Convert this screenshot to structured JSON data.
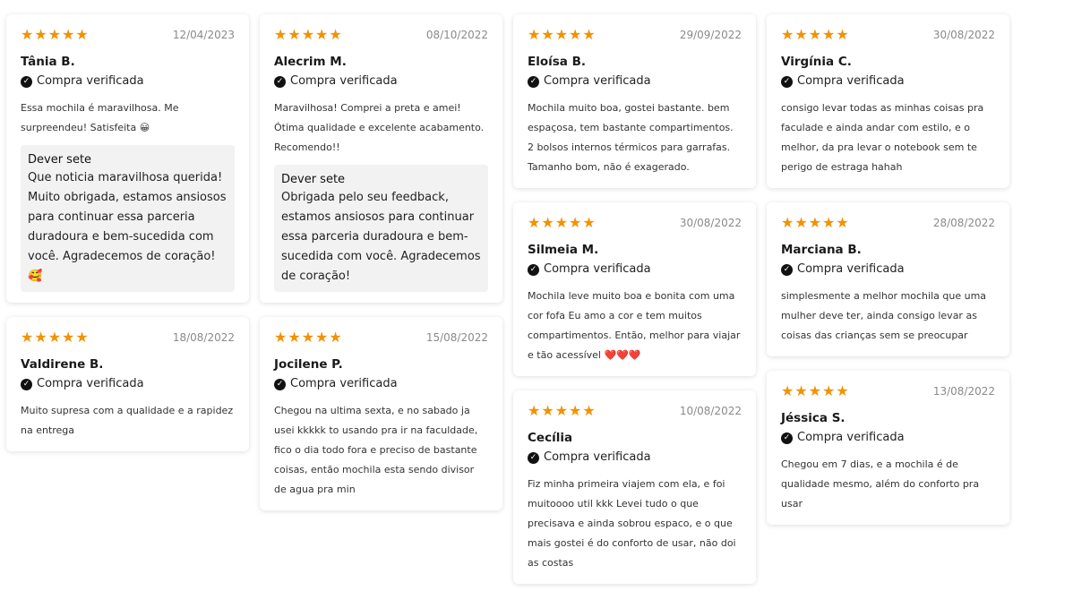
{
  "reviews": [
    {
      "stars": "★★★★★",
      "date": "12/04/2023",
      "name": "Tânia B.",
      "verified": "Compra verificada",
      "text": "Essa mochila é maravilhosa. Me surpreendeu! Satisfeita 😀",
      "reply_name": "Dever sete",
      "reply_text": "Que noticia maravilhosa querida! Muito obrigada, estamos ansiosos para continuar essa parceria duradoura e bem-sucedida com você. Agradecemos de coração! 🥰"
    },
    {
      "stars": "★★★★★",
      "date": "08/10/2022",
      "name": "Alecrim M.",
      "verified": "Compra verificada",
      "text": "Maravilhosa! Comprei a preta e amei! Ótima qualidade e excelente acabamento. Recomendo!!",
      "reply_name": "Dever sete",
      "reply_text": "Obrigada pelo seu feedback, estamos ansiosos para continuar essa parceria duradoura e bem-sucedida com você. Agradecemos de coração!"
    },
    {
      "stars": "★★★★★",
      "date": "29/09/2022",
      "name": "Eloísa B.",
      "verified": "Compra verificada",
      "text": "Mochila muito boa, gostei bastante. bem espaçosa, tem bastante compartimentos. 2 bolsos internos térmicos para garrafas. Tamanho bom, não é exagerado."
    },
    {
      "stars": "★★★★★",
      "date": "30/08/2022",
      "name": "Virgínia C.",
      "verified": "Compra verificada",
      "text": "consigo levar todas as minhas coisas pra faculade e ainda andar com estilo, e o melhor, da pra levar o notebook sem te perigo de estraga hahah"
    },
    {
      "stars": "★★★★★",
      "date": "18/08/2022",
      "name": "Valdirene B.",
      "verified": "Compra verificada",
      "text": "Muito supresa com a qualidade e a rapidez na entrega"
    },
    {
      "stars": "★★★★★",
      "date": "15/08/2022",
      "name": "Jocilene P.",
      "verified": "Compra verificada",
      "text": "Chegou na ultima sexta, e no sabado ja usei kkkkk to usando pra ir na faculdade, fico o dia todo fora e preciso de bastante coisas, então mochila esta sendo divisor de agua pra min"
    },
    {
      "stars": "★★★★★",
      "date": "30/08/2022",
      "name": "Silmeia M.",
      "verified": "Compra verificada",
      "text": "Mochila leve muito boa e bonita com uma cor fofa Eu amo a cor e tem muitos compartimentos. Então, melhor para viajar e tão acessível ❤️❤️❤️"
    },
    {
      "stars": "★★★★★",
      "date": "28/08/2022",
      "name": "Marciana B.",
      "verified": "Compra verificada",
      "text": "simplesmente a melhor mochila que uma mulher deve ter, ainda consigo levar as coisas das crianças sem se preocupar"
    },
    {
      "stars": "★★★★★",
      "date": "10/08/2022",
      "name": "Cecília",
      "verified": "Compra verificada",
      "text": "Fiz minha primeira viajem com ela, e foi muitoooo util kkk Levei tudo o que precisava e ainda sobrou espaco, e o que mais gostei é do conforto de usar, não doi as costas"
    },
    {
      "stars": "★★★★★",
      "date": "13/08/2022",
      "name": "Jéssica S.",
      "verified": "Compra verificada",
      "text": "Chegou em 7 dias, e a mochila é de qualidade mesmo, além do conforto pra usar"
    }
  ],
  "colors": {
    "star": "#f39200",
    "reply_bg": "#f2f2f2"
  },
  "icons": {
    "star": "star-icon",
    "verified": "check-circle-icon"
  }
}
